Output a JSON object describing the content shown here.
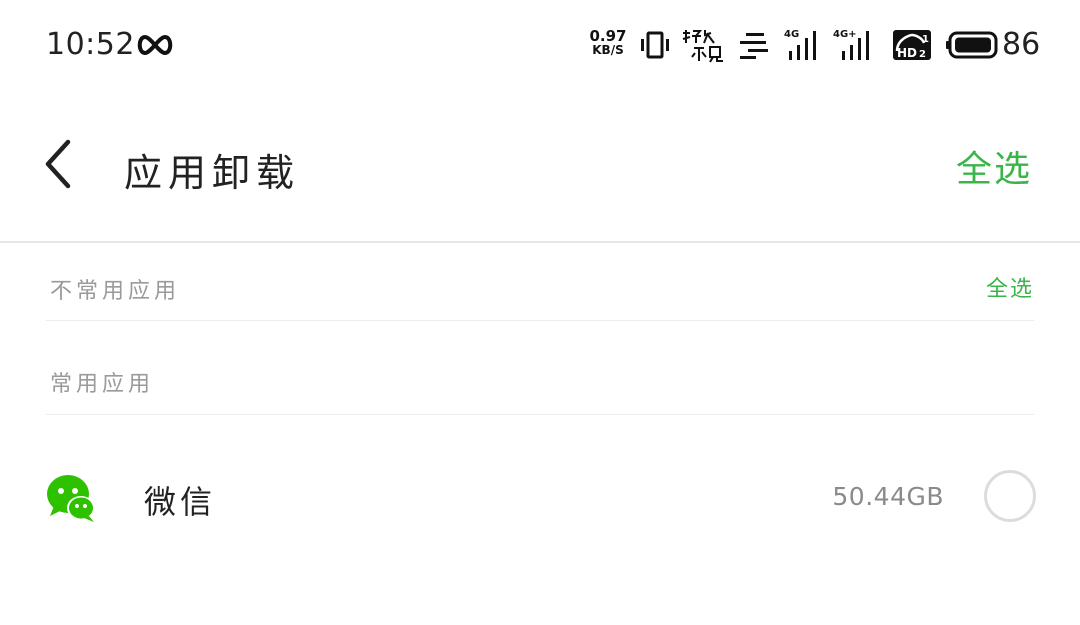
{
  "status_bar": {
    "time": "10:52",
    "net_speed_value": "0.97",
    "net_speed_unit": "KB/S",
    "battery_level": "86",
    "icons": [
      "infinity-icon",
      "vibrate-icon",
      "haojiubujian-icon",
      "data-bars-icon",
      "signal-4g-icon",
      "signal-4g-plus-icon",
      "hd-icon",
      "battery-icon"
    ]
  },
  "header": {
    "title": "应用卸载",
    "select_all_label": "全选"
  },
  "sections": [
    {
      "label": "不常用应用",
      "select_all_label": "全选"
    },
    {
      "label": "常用应用"
    }
  ],
  "apps": [
    {
      "name": "微信",
      "size": "50.44GB",
      "selected": false,
      "icon": "wechat-icon"
    }
  ],
  "colors": {
    "accent": "#3bb54a",
    "wechat_green": "#2dc100",
    "muted_text": "#9a9a9a",
    "divider": "#e6e6e6"
  }
}
